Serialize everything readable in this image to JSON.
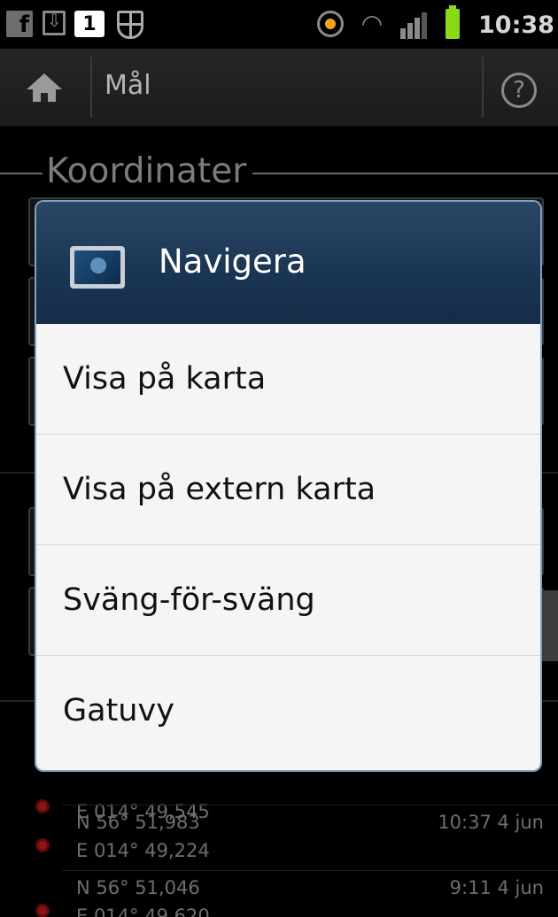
{
  "status_bar": {
    "calendar_day": "1",
    "time": "10:38",
    "icons": [
      "facebook-icon",
      "download-icon",
      "calendar-icon",
      "shield-icon",
      "gps-icon",
      "wifi-icon",
      "signal-icon",
      "battery-icon"
    ]
  },
  "action_bar": {
    "title": "Mål",
    "help_label": "?"
  },
  "background": {
    "section_title": "Koordinater",
    "history": [
      {
        "lat": "",
        "lon": "E 014° 49,545",
        "time": ""
      },
      {
        "lat": "N 56° 51,983",
        "lon": "E 014° 49,224",
        "time": "10:37 4 jun"
      },
      {
        "lat": "N 56° 51,046",
        "lon": "E 014° 49,620",
        "time": "9:11 4 jun"
      }
    ]
  },
  "dialog": {
    "title": "Navigera",
    "items": [
      {
        "label": "Visa på karta"
      },
      {
        "label": "Visa på extern karta"
      },
      {
        "label": "Sväng-för-sväng"
      },
      {
        "label": "Gatuvy"
      }
    ]
  },
  "colors": {
    "dialog_header": "#1a3554",
    "dialog_body": "#f5f5f5",
    "history_dot": "#8c1414"
  }
}
